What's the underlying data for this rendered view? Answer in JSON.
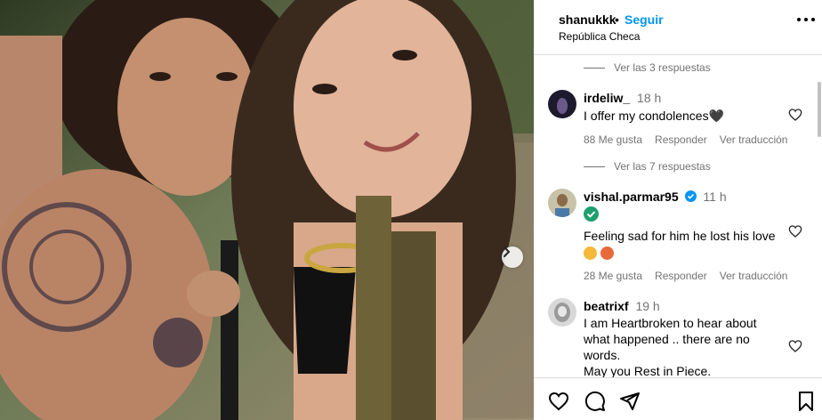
{
  "post": {
    "username": "shanukkk",
    "separator": "•",
    "follow_label": "Seguir",
    "location": "República Checa"
  },
  "comments": {
    "toggle_1": "Ver las 3 respuestas",
    "toggle_2": "Ver las 7 respuestas",
    "items": [
      {
        "user": "irdeliw_",
        "time": "18 h",
        "text": "I offer my condolences🖤",
        "likes": "88 Me gusta",
        "reply": "Responder",
        "translate": "Ver traducción"
      },
      {
        "user": "vishal.parmar95",
        "time": "11 h",
        "text": "Feeling sad for him he lost his love",
        "likes": "28 Me gusta",
        "reply": "Responder",
        "translate": "Ver traducción"
      },
      {
        "user": "beatrixf",
        "time": "19 h",
        "text": "I am Heartbroken to hear about\nwhat happened .. there are no\nwords.\nMay you Rest in Piece."
      }
    ]
  },
  "icons": {
    "next": "chevron-right-icon",
    "more": "more-options-icon",
    "like": "heart-icon",
    "comment": "comment-icon",
    "share": "share-icon",
    "save": "bookmark-icon"
  },
  "colors": {
    "link_blue": "#0095f6",
    "muted": "#737373",
    "border": "#dbdbdb"
  }
}
